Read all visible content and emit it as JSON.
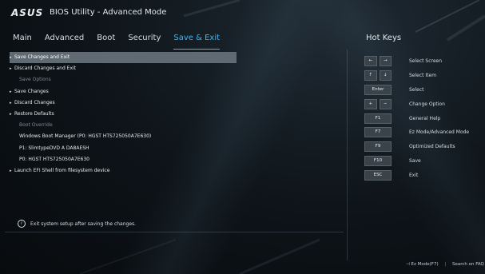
{
  "header": {
    "logo": "ASUS",
    "title": "BIOS Utility - Advanced Mode"
  },
  "tabs": [
    {
      "label": "Main"
    },
    {
      "label": "Advanced"
    },
    {
      "label": "Boot"
    },
    {
      "label": "Security"
    },
    {
      "label": "Save & Exit"
    }
  ],
  "active_tab": "Save & Exit",
  "menu": [
    {
      "label": "Save Changes and Exit",
      "kind": "sub",
      "selected": true
    },
    {
      "label": "Discard Changes and Exit",
      "kind": "sub"
    },
    {
      "label": "Save Options",
      "kind": "header"
    },
    {
      "label": "Save Changes",
      "kind": "sub"
    },
    {
      "label": "Discard Changes",
      "kind": "sub"
    },
    {
      "label": "Restore Defaults",
      "kind": "sub"
    },
    {
      "label": "Boot Override",
      "kind": "header"
    },
    {
      "label": "Windows Boot Manager (P0: HGST HTS725050A7E630)",
      "kind": "plain"
    },
    {
      "label": "P1: SlimtypeDVD A  DA8AESH",
      "kind": "plain"
    },
    {
      "label": "P0: HGST HTS725050A7E630",
      "kind": "plain"
    },
    {
      "label": "Launch EFI Shell from filesystem device",
      "kind": "sub"
    }
  ],
  "hotkeys": {
    "title": "Hot Keys",
    "items": [
      {
        "keys": [
          "←",
          "→"
        ],
        "label": "Select Screen"
      },
      {
        "keys": [
          "↑",
          "↓"
        ],
        "label": "Select Item"
      },
      {
        "keys": [
          "Enter"
        ],
        "label": "Select"
      },
      {
        "keys": [
          "+",
          "−"
        ],
        "label": "Change Option"
      },
      {
        "keys": [
          "F1"
        ],
        "label": "General Help"
      },
      {
        "keys": [
          "F7"
        ],
        "label": "Ez Mode/Advanced Mode"
      },
      {
        "keys": [
          "F9"
        ],
        "label": "Optimized Defaults"
      },
      {
        "keys": [
          "F10"
        ],
        "label": "Save"
      },
      {
        "keys": [
          "ESC"
        ],
        "label": "Exit"
      }
    ]
  },
  "help_text": "Exit system setup after saving the changes.",
  "footer": {
    "ez_mode": "Ez Mode(F7)",
    "search": "Search on FAQ"
  },
  "colors": {
    "accent": "#3fb6f0",
    "selected_row": "#5f6a72"
  }
}
